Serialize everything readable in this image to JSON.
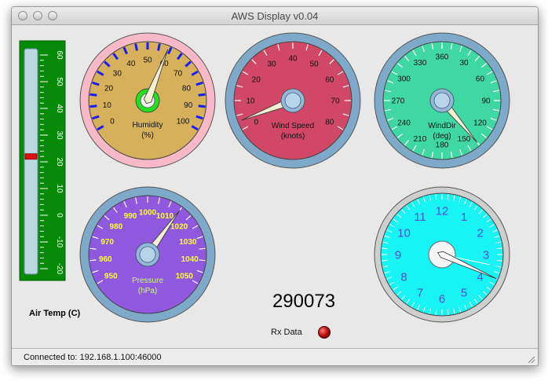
{
  "window": {
    "title": "AWS Display v0.04"
  },
  "thermometer": {
    "label": "Air Temp (C)",
    "ticks": [
      "60",
      "50",
      "40",
      "30",
      "20",
      "10",
      "0",
      "-10",
      "-20"
    ],
    "value": 22,
    "min": -20,
    "max": 60
  },
  "humidity": {
    "title": "Humidity",
    "unit": "(%)",
    "ticks": [
      "0",
      "10",
      "20",
      "30",
      "40",
      "50",
      "60",
      "70",
      "80",
      "90",
      "100"
    ],
    "min": 0,
    "max": 100,
    "value": 59,
    "bezel_color": "#f7b8c8"
  },
  "wind_speed": {
    "title": "Wind Speed",
    "unit": "(knots)",
    "ticks": [
      "0",
      "10",
      "20",
      "30",
      "40",
      "50",
      "60",
      "70",
      "80"
    ],
    "min": 0,
    "max": 80,
    "value": 3
  },
  "wind_dir": {
    "title": "WindDir",
    "unit": "(deg)",
    "ticks": [
      "360",
      "30",
      "60",
      "90",
      "120",
      "150",
      "180",
      "210",
      "240",
      "270",
      "300",
      "330"
    ],
    "value": 140
  },
  "pressure": {
    "title": "Pressure",
    "unit": "(hPa)",
    "ticks": [
      "950",
      "960",
      "970",
      "980",
      "990",
      "1000",
      "1010",
      "1020",
      "1030",
      "1040",
      "1050"
    ],
    "min": 950,
    "max": 1050,
    "value": 1015
  },
  "clock": {
    "numbers": [
      "12",
      "1",
      "2",
      "3",
      "4",
      "5",
      "6",
      "7",
      "8",
      "9",
      "10",
      "11"
    ],
    "hour_value": 3.3,
    "minute_value": 17
  },
  "readout": {
    "value": "290073"
  },
  "rx": {
    "label": "Rx Data"
  },
  "status": {
    "text": "Connected to: 192.168.1.100:46000"
  },
  "colors": {
    "humidity_face": "#d6b05a",
    "wind_speed_face": "#d04865",
    "wind_dir_face": "#3fd7a3",
    "pressure_face": "#8f58df",
    "clock_face": "#18f4f4",
    "bezel": "#7ea9c8"
  }
}
